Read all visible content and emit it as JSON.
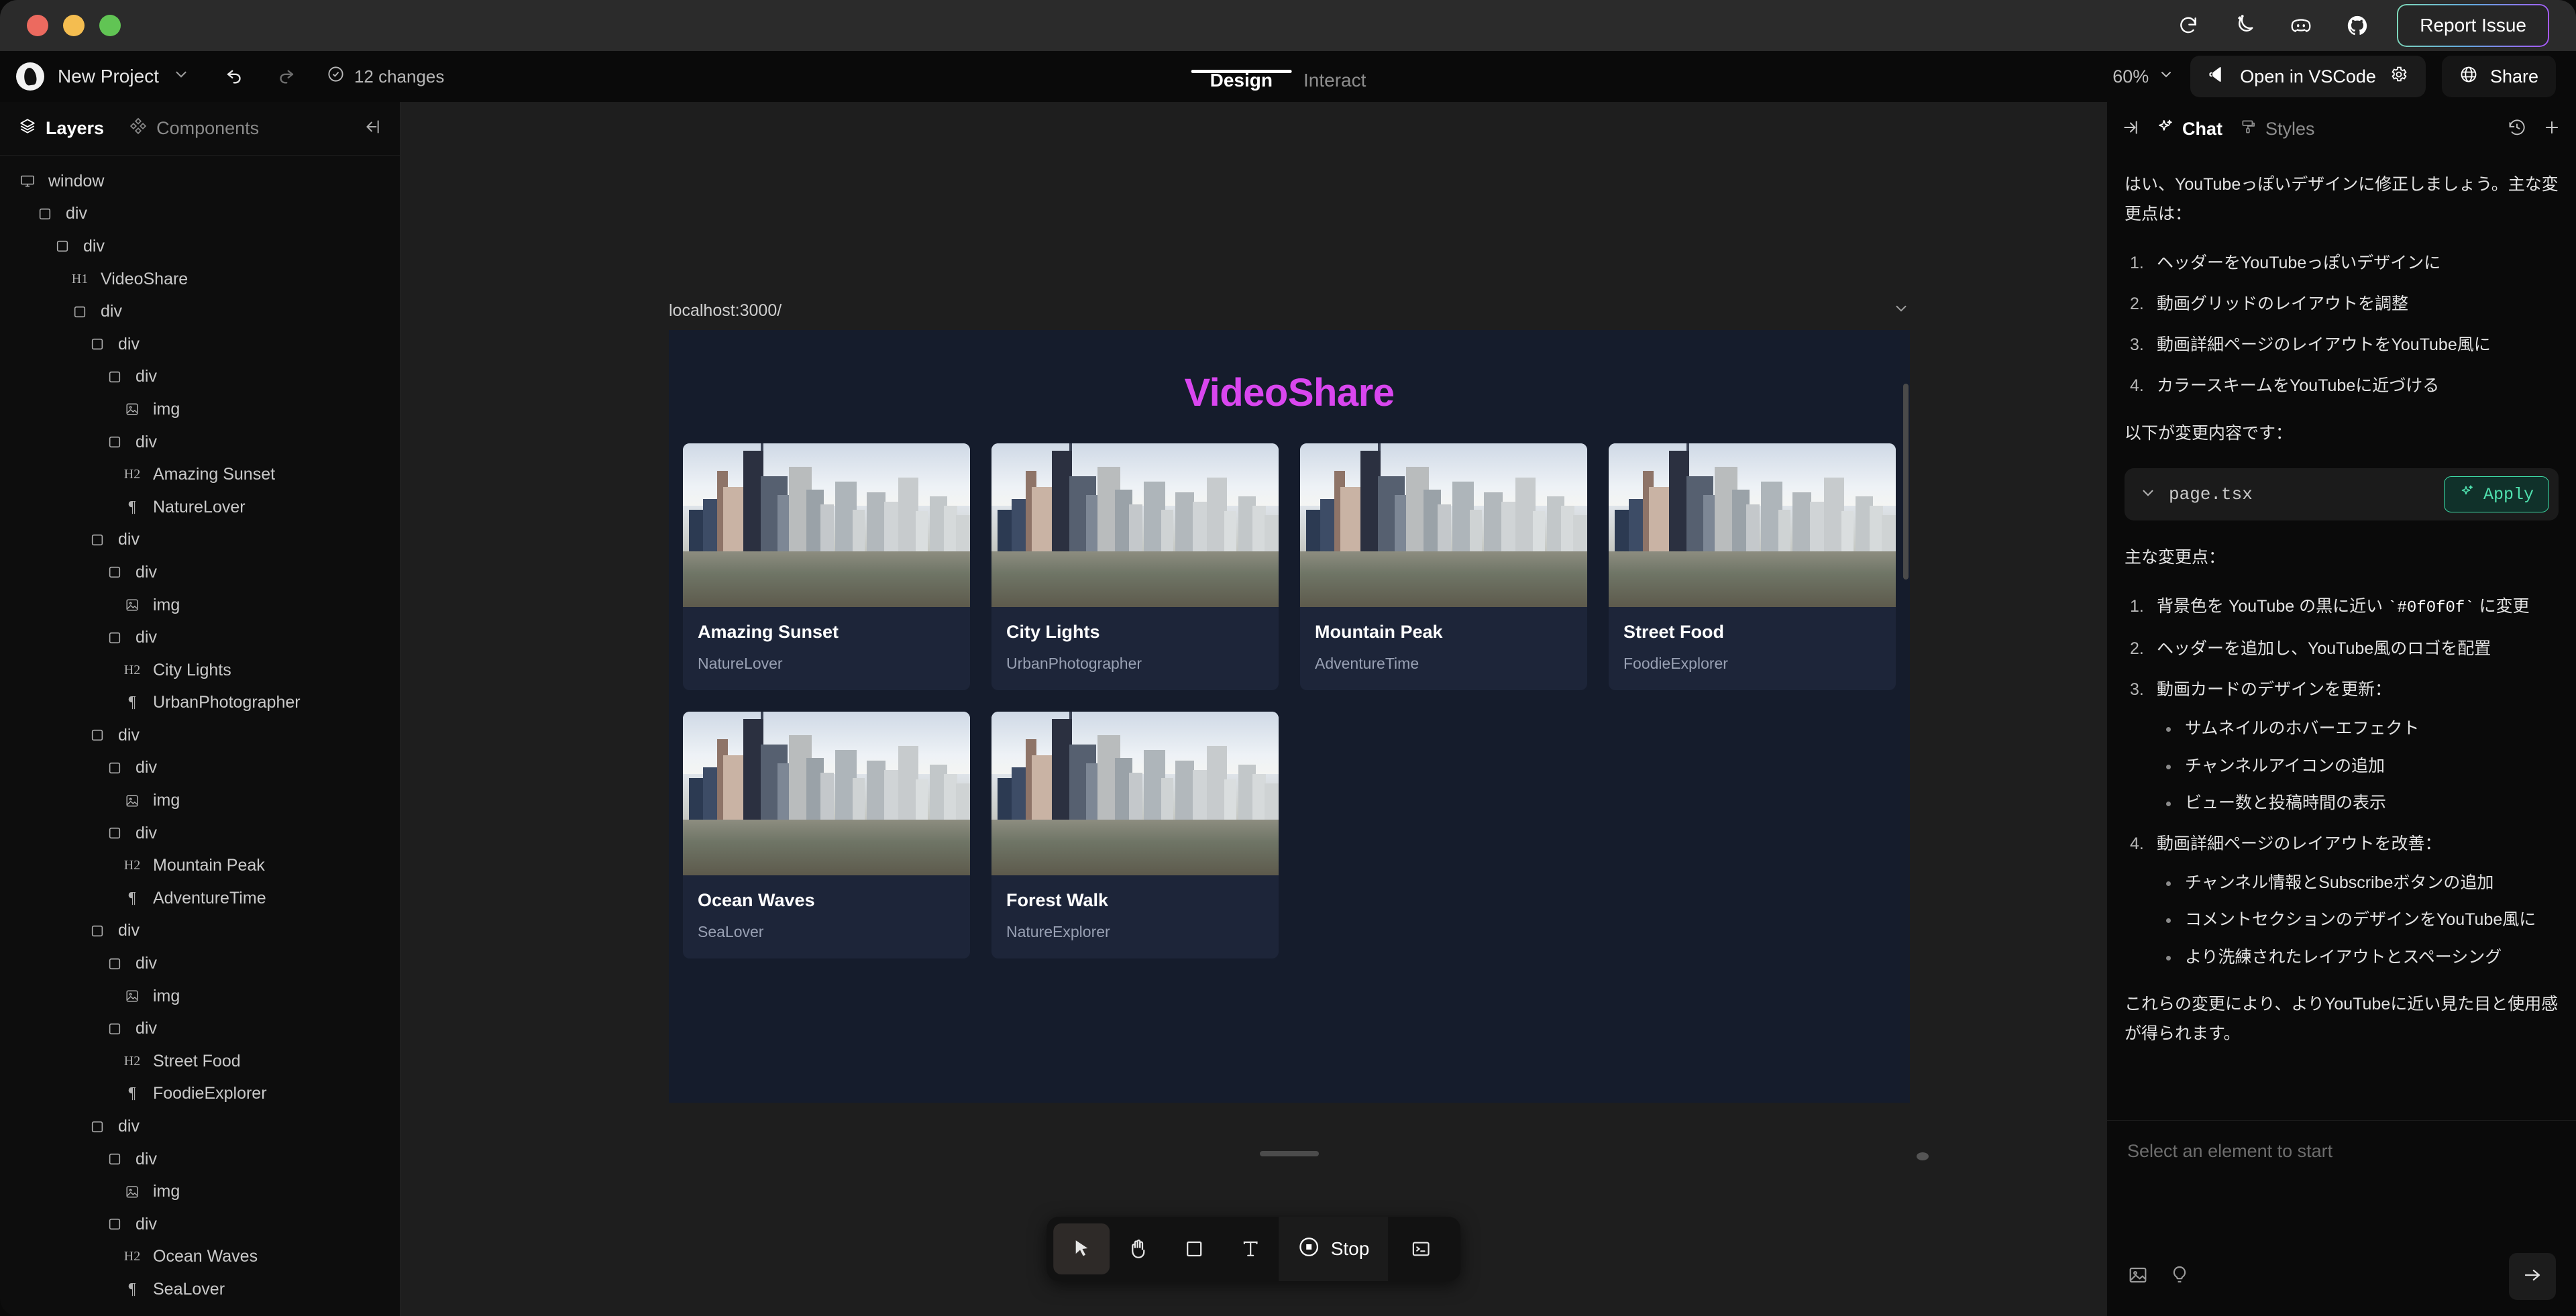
{
  "titlebar": {
    "icons": [
      "refresh-icon",
      "dark-mode-icon",
      "discord-icon",
      "github-icon"
    ],
    "report_issue_label": "Report Issue",
    "gradient_from": "#7fd9b8",
    "gradient_to": "#a855f7"
  },
  "toolbar": {
    "project_name": "New Project",
    "changes_label": "12 changes",
    "zoom_level": "60%",
    "open_vscode_label": "Open in VSCode",
    "share_label": "Share",
    "tabs": [
      {
        "label": "Design",
        "active": true
      },
      {
        "label": "Interact",
        "active": false
      }
    ]
  },
  "left_panel": {
    "tabs": [
      {
        "label": "Layers",
        "icon": "layers-icon",
        "active": true
      },
      {
        "label": "Components",
        "icon": "components-icon",
        "active": false
      }
    ],
    "collapse_icon": "collapse-left-icon",
    "layers": [
      {
        "label": "window",
        "type": "window",
        "depth": 0
      },
      {
        "label": "div",
        "type": "div",
        "depth": 1
      },
      {
        "label": "div",
        "type": "div",
        "depth": 2
      },
      {
        "label": "VideoShare",
        "type": "h1",
        "depth": 3
      },
      {
        "label": "div",
        "type": "div",
        "depth": 3
      },
      {
        "label": "div",
        "type": "div",
        "depth": 4
      },
      {
        "label": "div",
        "type": "div",
        "depth": 5
      },
      {
        "label": "img",
        "type": "img",
        "depth": 6
      },
      {
        "label": "div",
        "type": "div",
        "depth": 5
      },
      {
        "label": "Amazing Sunset",
        "type": "h2",
        "depth": 6
      },
      {
        "label": "NatureLover",
        "type": "p",
        "depth": 6
      },
      {
        "label": "div",
        "type": "div",
        "depth": 4
      },
      {
        "label": "div",
        "type": "div",
        "depth": 5
      },
      {
        "label": "img",
        "type": "img",
        "depth": 6
      },
      {
        "label": "div",
        "type": "div",
        "depth": 5
      },
      {
        "label": "City Lights",
        "type": "h2",
        "depth": 6
      },
      {
        "label": "UrbanPhotographer",
        "type": "p",
        "depth": 6
      },
      {
        "label": "div",
        "type": "div",
        "depth": 4
      },
      {
        "label": "div",
        "type": "div",
        "depth": 5
      },
      {
        "label": "img",
        "type": "img",
        "depth": 6
      },
      {
        "label": "div",
        "type": "div",
        "depth": 5
      },
      {
        "label": "Mountain Peak",
        "type": "h2",
        "depth": 6
      },
      {
        "label": "AdventureTime",
        "type": "p",
        "depth": 6
      },
      {
        "label": "div",
        "type": "div",
        "depth": 4
      },
      {
        "label": "div",
        "type": "div",
        "depth": 5
      },
      {
        "label": "img",
        "type": "img",
        "depth": 6
      },
      {
        "label": "div",
        "type": "div",
        "depth": 5
      },
      {
        "label": "Street Food",
        "type": "h2",
        "depth": 6
      },
      {
        "label": "FoodieExplorer",
        "type": "p",
        "depth": 6
      },
      {
        "label": "div",
        "type": "div",
        "depth": 4
      },
      {
        "label": "div",
        "type": "div",
        "depth": 5
      },
      {
        "label": "img",
        "type": "img",
        "depth": 6
      },
      {
        "label": "div",
        "type": "div",
        "depth": 5
      },
      {
        "label": "Ocean Waves",
        "type": "h2",
        "depth": 6
      },
      {
        "label": "SeaLover",
        "type": "p",
        "depth": 6
      }
    ]
  },
  "canvas": {
    "url": "localhost:3000/",
    "preview": {
      "site_title": "VideoShare",
      "site_title_color": "#d946ef",
      "background": "#151c2c",
      "cards": [
        {
          "title": "Amazing Sunset",
          "channel": "NatureLover"
        },
        {
          "title": "City Lights",
          "channel": "UrbanPhotographer"
        },
        {
          "title": "Mountain Peak",
          "channel": "AdventureTime"
        },
        {
          "title": "Street Food",
          "channel": "FoodieExplorer"
        },
        {
          "title": "Ocean Waves",
          "channel": "SeaLover"
        },
        {
          "title": "Forest Walk",
          "channel": "NatureExplorer"
        }
      ]
    }
  },
  "bottom_tools": {
    "tools": [
      {
        "name": "cursor-tool",
        "icon": "cursor-icon",
        "active": true
      },
      {
        "name": "hand-tool",
        "icon": "hand-icon",
        "active": false
      },
      {
        "name": "rectangle-tool",
        "icon": "rectangle-icon",
        "active": false
      },
      {
        "name": "text-tool",
        "icon": "text-icon",
        "active": false
      }
    ],
    "stop_label": "Stop",
    "terminal_icon": "terminal-icon"
  },
  "right_panel": {
    "tabs": [
      {
        "label": "Chat",
        "icon": "sparkle-icon",
        "active": true
      },
      {
        "label": "Styles",
        "icon": "paint-roller-icon",
        "active": false
      }
    ],
    "history_icon": "history-icon",
    "new_chat_icon": "plus-icon",
    "message": {
      "intro": "はい、YouTubeっぽいデザインに修正しましょう。主な変更点は：",
      "steps": [
        "ヘッダーをYouTubeっぽいデザインに",
        "動画グリッドのレイアウトを調整",
        "動画詳細ページのレイアウトをYouTube風に",
        "カラースキームをYouTubeに近づける"
      ],
      "diff_intro": "以下が変更内容です：",
      "file_name": "page.tsx",
      "apply_label": "Apply",
      "changes_heading": "主な変更点：",
      "change_1_prefix": "背景色を YouTube の黒に近い ",
      "change_1_code": "#0f0f0f",
      "change_1_suffix": " に変更",
      "change_2": "ヘッダーを追加し、YouTube風のロゴを配置",
      "change_3": "動画カードのデザインを更新：",
      "change_3_sub": [
        "サムネイルのホバーエフェクト",
        "チャンネルアイコンの追加",
        "ビュー数と投稿時間の表示"
      ],
      "change_4": "動画詳細ページのレイアウトを改善：",
      "change_4_sub": [
        "チャンネル情報とSubscribeボタンの追加",
        "コメントセクションのデザインをYouTube風に",
        "より洗練されたレイアウトとスペーシング"
      ],
      "outro": "これらの変更により、よりYouTubeに近い見た目と使用感が得られます。"
    },
    "input_placeholder": "Select an element to start",
    "input_icons": [
      "image-icon",
      "lightbulb-icon"
    ],
    "send_icon": "arrow-right-icon"
  }
}
